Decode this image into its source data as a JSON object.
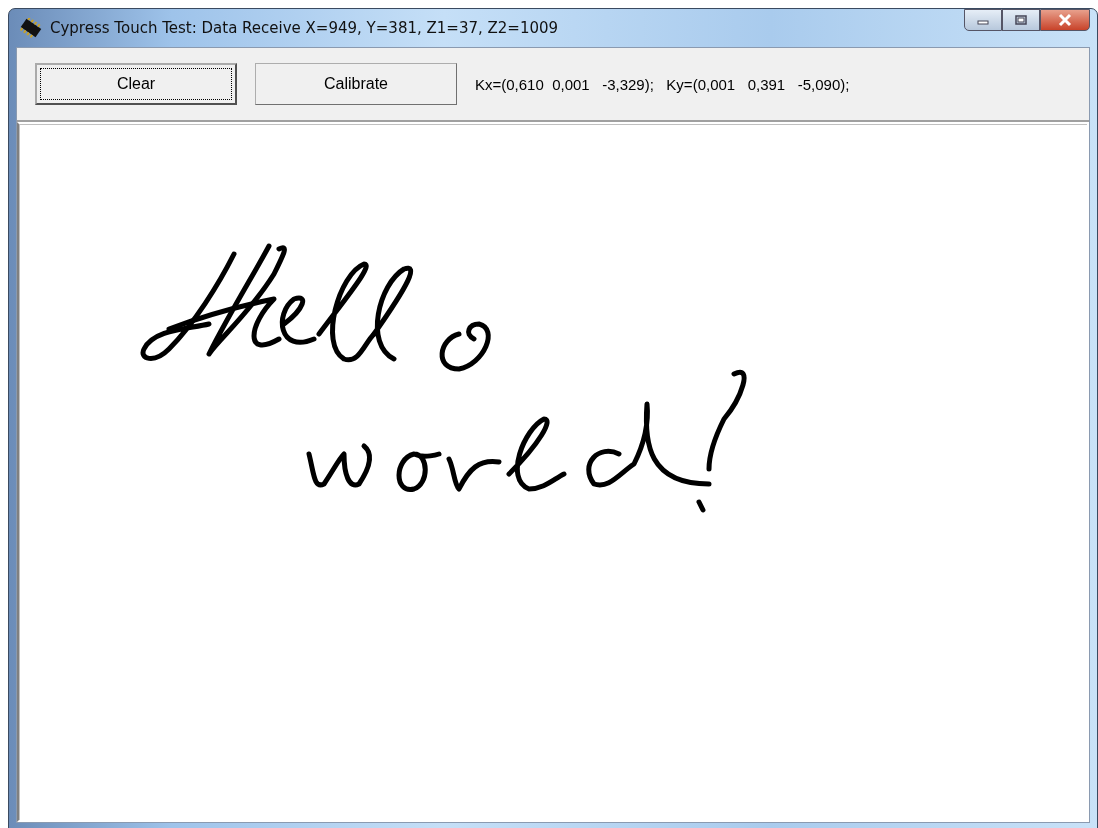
{
  "window": {
    "title": "Cypress Touch Test: Data Receive X=949, Y=381, Z1=37, Z2=1009"
  },
  "buttons": [
    {
      "label": "Clear",
      "focused": true
    },
    {
      "label": "Calibrate",
      "focused": false
    }
  ],
  "coefficients": "Kx=(0,610  0,001   -3,329);   Ky=(0,001   0,391   -5,090);"
}
